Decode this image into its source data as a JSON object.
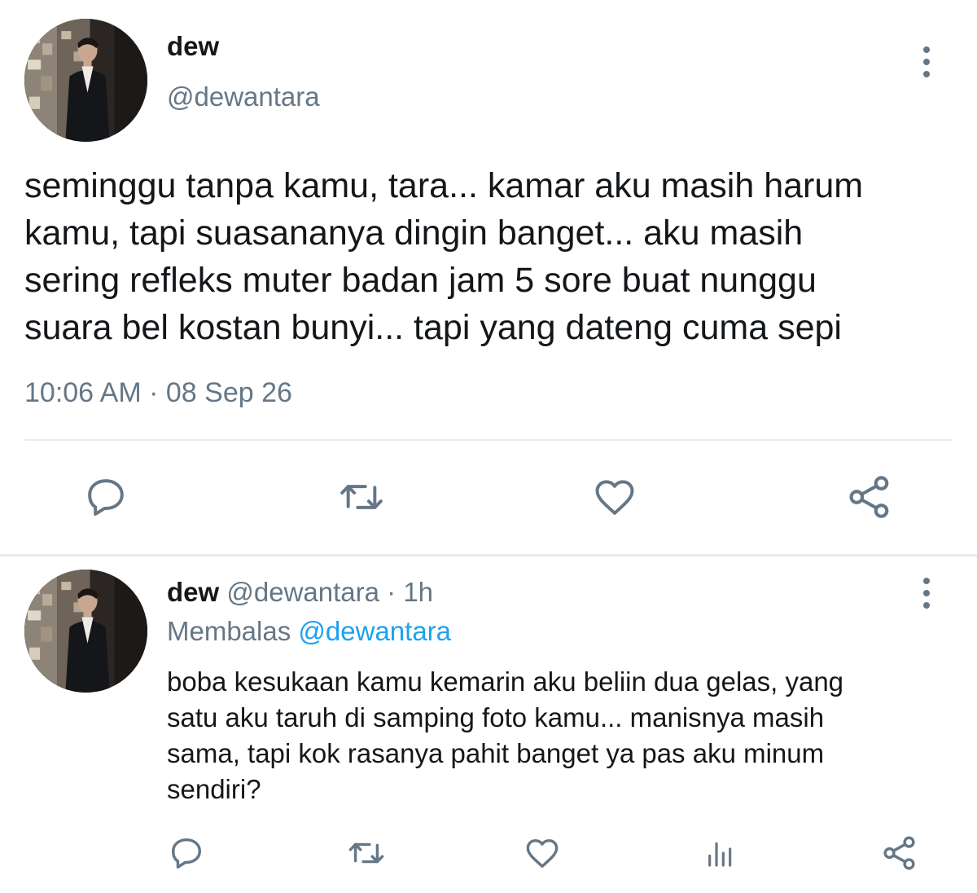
{
  "colors": {
    "text": "#14171a",
    "secondary": "#657786",
    "link": "#1da1f2",
    "divider": "#e6ecf0",
    "icon": "#657786"
  },
  "main_tweet": {
    "display_name": "dew",
    "handle": "@dewantara",
    "text": "seminggu tanpa kamu, tara... kamar aku masih harum\nkamu, tapi suasananya dingin banget... aku masih\nsering refleks muter badan jam 5 sore buat nunggu\nsuara bel kostan bunyi... tapi yang dateng cuma sepi",
    "time": "10:06 AM",
    "separator": "·",
    "date": "08 Sep 26",
    "actions": [
      "reply-icon",
      "retweet-icon",
      "like-icon",
      "share-icon"
    ]
  },
  "reply_tweet": {
    "display_name": "dew",
    "handle": "@dewantara",
    "separator": "·",
    "age": "1h",
    "replying_label": "Membalas",
    "replying_to": "@dewantara",
    "text": "boba kesukaan kamu kemarin aku beliin dua gelas, yang\nsatu aku taruh di samping foto kamu... manisnya masih\nsama, tapi kok rasanya pahit banget ya pas aku minum\nsendiri?",
    "actions": [
      "reply-icon",
      "retweet-icon",
      "like-icon",
      "analytics-icon",
      "share-icon"
    ]
  }
}
